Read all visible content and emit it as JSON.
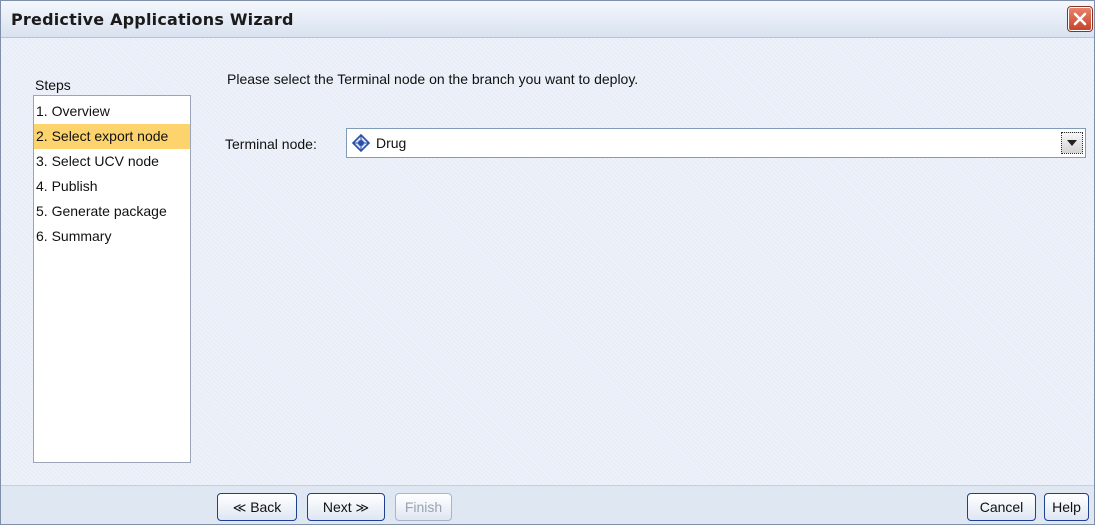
{
  "window": {
    "title": "Predictive Applications Wizard"
  },
  "steps": {
    "title": "Steps",
    "items": [
      {
        "label": "1. Overview",
        "active": false
      },
      {
        "label": "2. Select export node",
        "active": true
      },
      {
        "label": "3. Select UCV node",
        "active": false
      },
      {
        "label": "4. Publish",
        "active": false
      },
      {
        "label": "5. Generate package",
        "active": false
      },
      {
        "label": "6. Summary",
        "active": false
      }
    ]
  },
  "main": {
    "instruction": "Please select the Terminal node on the branch you want to deploy.",
    "terminal_node": {
      "label": "Terminal node:",
      "value": "Drug",
      "icon": "type-node-icon"
    }
  },
  "footer": {
    "back": {
      "label": "Back",
      "glyph": "≪"
    },
    "next": {
      "label": "Next",
      "glyph": "≫"
    },
    "finish": {
      "label": "Finish",
      "enabled": false
    },
    "cancel": {
      "label": "Cancel"
    },
    "help": {
      "label": "Help"
    }
  },
  "colors": {
    "active_step": "#fdd36d",
    "button_border": "#1f3f8f",
    "close_button": "#c8432c"
  }
}
